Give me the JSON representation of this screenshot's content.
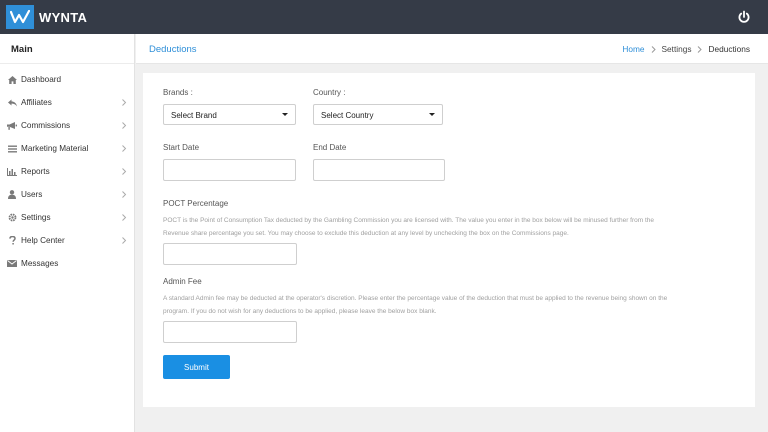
{
  "app": {
    "name": "WYNTA",
    "brand_color": "#2f8fd8",
    "topbar_color": "#353b47"
  },
  "sidebar": {
    "heading": "Main",
    "items": [
      {
        "label": "Dashboard",
        "icon": "home-icon",
        "has_chevron": false
      },
      {
        "label": "Affiliates",
        "icon": "reply-icon",
        "has_chevron": true
      },
      {
        "label": "Commissions",
        "icon": "bullhorn-icon",
        "has_chevron": true
      },
      {
        "label": "Marketing Material",
        "icon": "list-icon",
        "has_chevron": true
      },
      {
        "label": "Reports",
        "icon": "bar-chart-icon",
        "has_chevron": true
      },
      {
        "label": "Users",
        "icon": "user-icon",
        "has_chevron": true
      },
      {
        "label": "Settings",
        "icon": "gear-icon",
        "has_chevron": true
      },
      {
        "label": "Help Center",
        "icon": "question-icon",
        "has_chevron": true
      },
      {
        "label": "Messages",
        "icon": "envelope-icon",
        "has_chevron": false
      }
    ]
  },
  "header": {
    "title": "Deductions",
    "breadcrumb": [
      "Home",
      "Settings",
      "Deductions"
    ]
  },
  "form": {
    "brands_label": "Brands :",
    "brands_value": "Select Brand",
    "country_label": "Country :",
    "country_value": "Select Country",
    "start_date_label": "Start Date",
    "start_date_value": "",
    "end_date_label": "End Date",
    "end_date_value": "",
    "poct_label": "POCT Percentage",
    "poct_help_1": "POCT is the Point of Consumption Tax deducted by the Gambling Commission you are licensed with. The value you enter in the box below will be minused further from the",
    "poct_help_2": "Revenue share percentage you set. You may choose to exclude this deduction at any level by unchecking the box on the Commissions page.",
    "poct_value": "",
    "admin_label": "Admin Fee",
    "admin_help_1": "A standard Admin fee may be deducted at the operator's discretion. Please enter the percentage value of the deduction that must be applied to the revenue being shown on the",
    "admin_help_2": "program. If you do not wish for any deductions to be applied, please leave the below box blank.",
    "admin_value": "",
    "submit_label": "Submit"
  }
}
